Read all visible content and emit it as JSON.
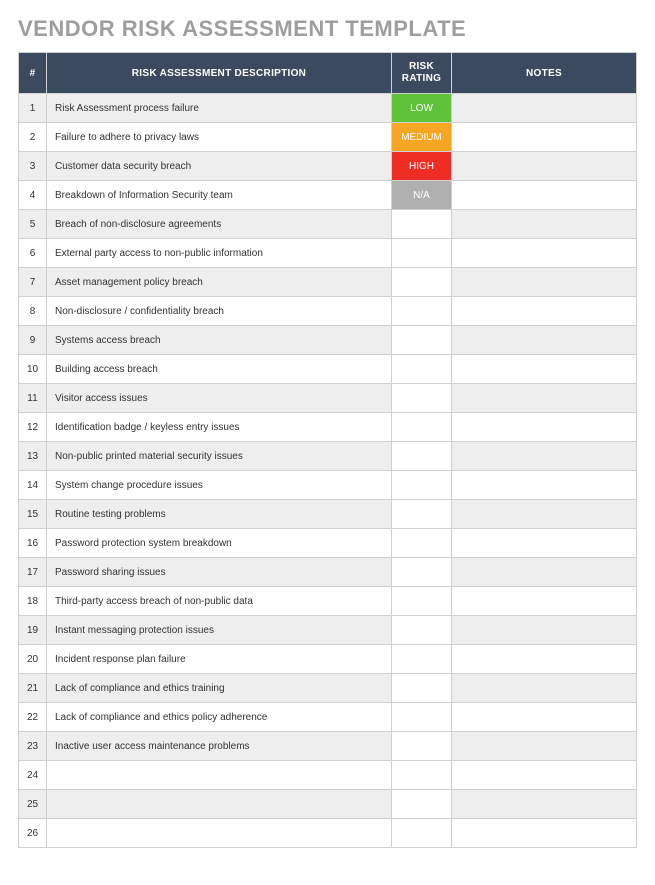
{
  "title": "VENDOR RISK ASSESSMENT TEMPLATE",
  "headers": {
    "num": "#",
    "desc": "RISK ASSESSMENT DESCRIPTION",
    "rating": "RISK RATING",
    "notes": "NOTES"
  },
  "ratingColors": {
    "LOW": "rating-low",
    "MEDIUM": "rating-medium",
    "HIGH": "rating-high",
    "N/A": "rating-na"
  },
  "rows": [
    {
      "num": "1",
      "desc": "Risk Assessment process failure",
      "rating": "LOW",
      "notes": ""
    },
    {
      "num": "2",
      "desc": "Failure to adhere to privacy laws",
      "rating": "MEDIUM",
      "notes": ""
    },
    {
      "num": "3",
      "desc": "Customer data security breach",
      "rating": "HIGH",
      "notes": ""
    },
    {
      "num": "4",
      "desc": "Breakdown of Information Security team",
      "rating": "N/A",
      "notes": ""
    },
    {
      "num": "5",
      "desc": "Breach of non-disclosure agreements",
      "rating": "",
      "notes": ""
    },
    {
      "num": "6",
      "desc": "External party access to non-public information",
      "rating": "",
      "notes": ""
    },
    {
      "num": "7",
      "desc": "Asset management policy breach",
      "rating": "",
      "notes": ""
    },
    {
      "num": "8",
      "desc": "Non-disclosure / confidentiality breach",
      "rating": "",
      "notes": ""
    },
    {
      "num": "9",
      "desc": "Systems access breach",
      "rating": "",
      "notes": ""
    },
    {
      "num": "10",
      "desc": "Building access breach",
      "rating": "",
      "notes": ""
    },
    {
      "num": "11",
      "desc": "Visitor access issues",
      "rating": "",
      "notes": ""
    },
    {
      "num": "12",
      "desc": "Identification badge / keyless entry issues",
      "rating": "",
      "notes": ""
    },
    {
      "num": "13",
      "desc": "Non-public printed material security issues",
      "rating": "",
      "notes": ""
    },
    {
      "num": "14",
      "desc": "System change procedure issues",
      "rating": "",
      "notes": ""
    },
    {
      "num": "15",
      "desc": "Routine testing problems",
      "rating": "",
      "notes": ""
    },
    {
      "num": "16",
      "desc": "Password protection system breakdown",
      "rating": "",
      "notes": ""
    },
    {
      "num": "17",
      "desc": "Password sharing issues",
      "rating": "",
      "notes": ""
    },
    {
      "num": "18",
      "desc": "Third-party access breach of non-public data",
      "rating": "",
      "notes": ""
    },
    {
      "num": "19",
      "desc": "Instant messaging protection issues",
      "rating": "",
      "notes": ""
    },
    {
      "num": "20",
      "desc": "Incident response plan failure",
      "rating": "",
      "notes": ""
    },
    {
      "num": "21",
      "desc": "Lack of compliance and ethics training",
      "rating": "",
      "notes": ""
    },
    {
      "num": "22",
      "desc": "Lack of compliance and ethics policy adherence",
      "rating": "",
      "notes": ""
    },
    {
      "num": "23",
      "desc": "Inactive user access maintenance problems",
      "rating": "",
      "notes": ""
    },
    {
      "num": "24",
      "desc": "",
      "rating": "",
      "notes": ""
    },
    {
      "num": "25",
      "desc": "",
      "rating": "",
      "notes": ""
    },
    {
      "num": "26",
      "desc": "",
      "rating": "",
      "notes": ""
    }
  ]
}
